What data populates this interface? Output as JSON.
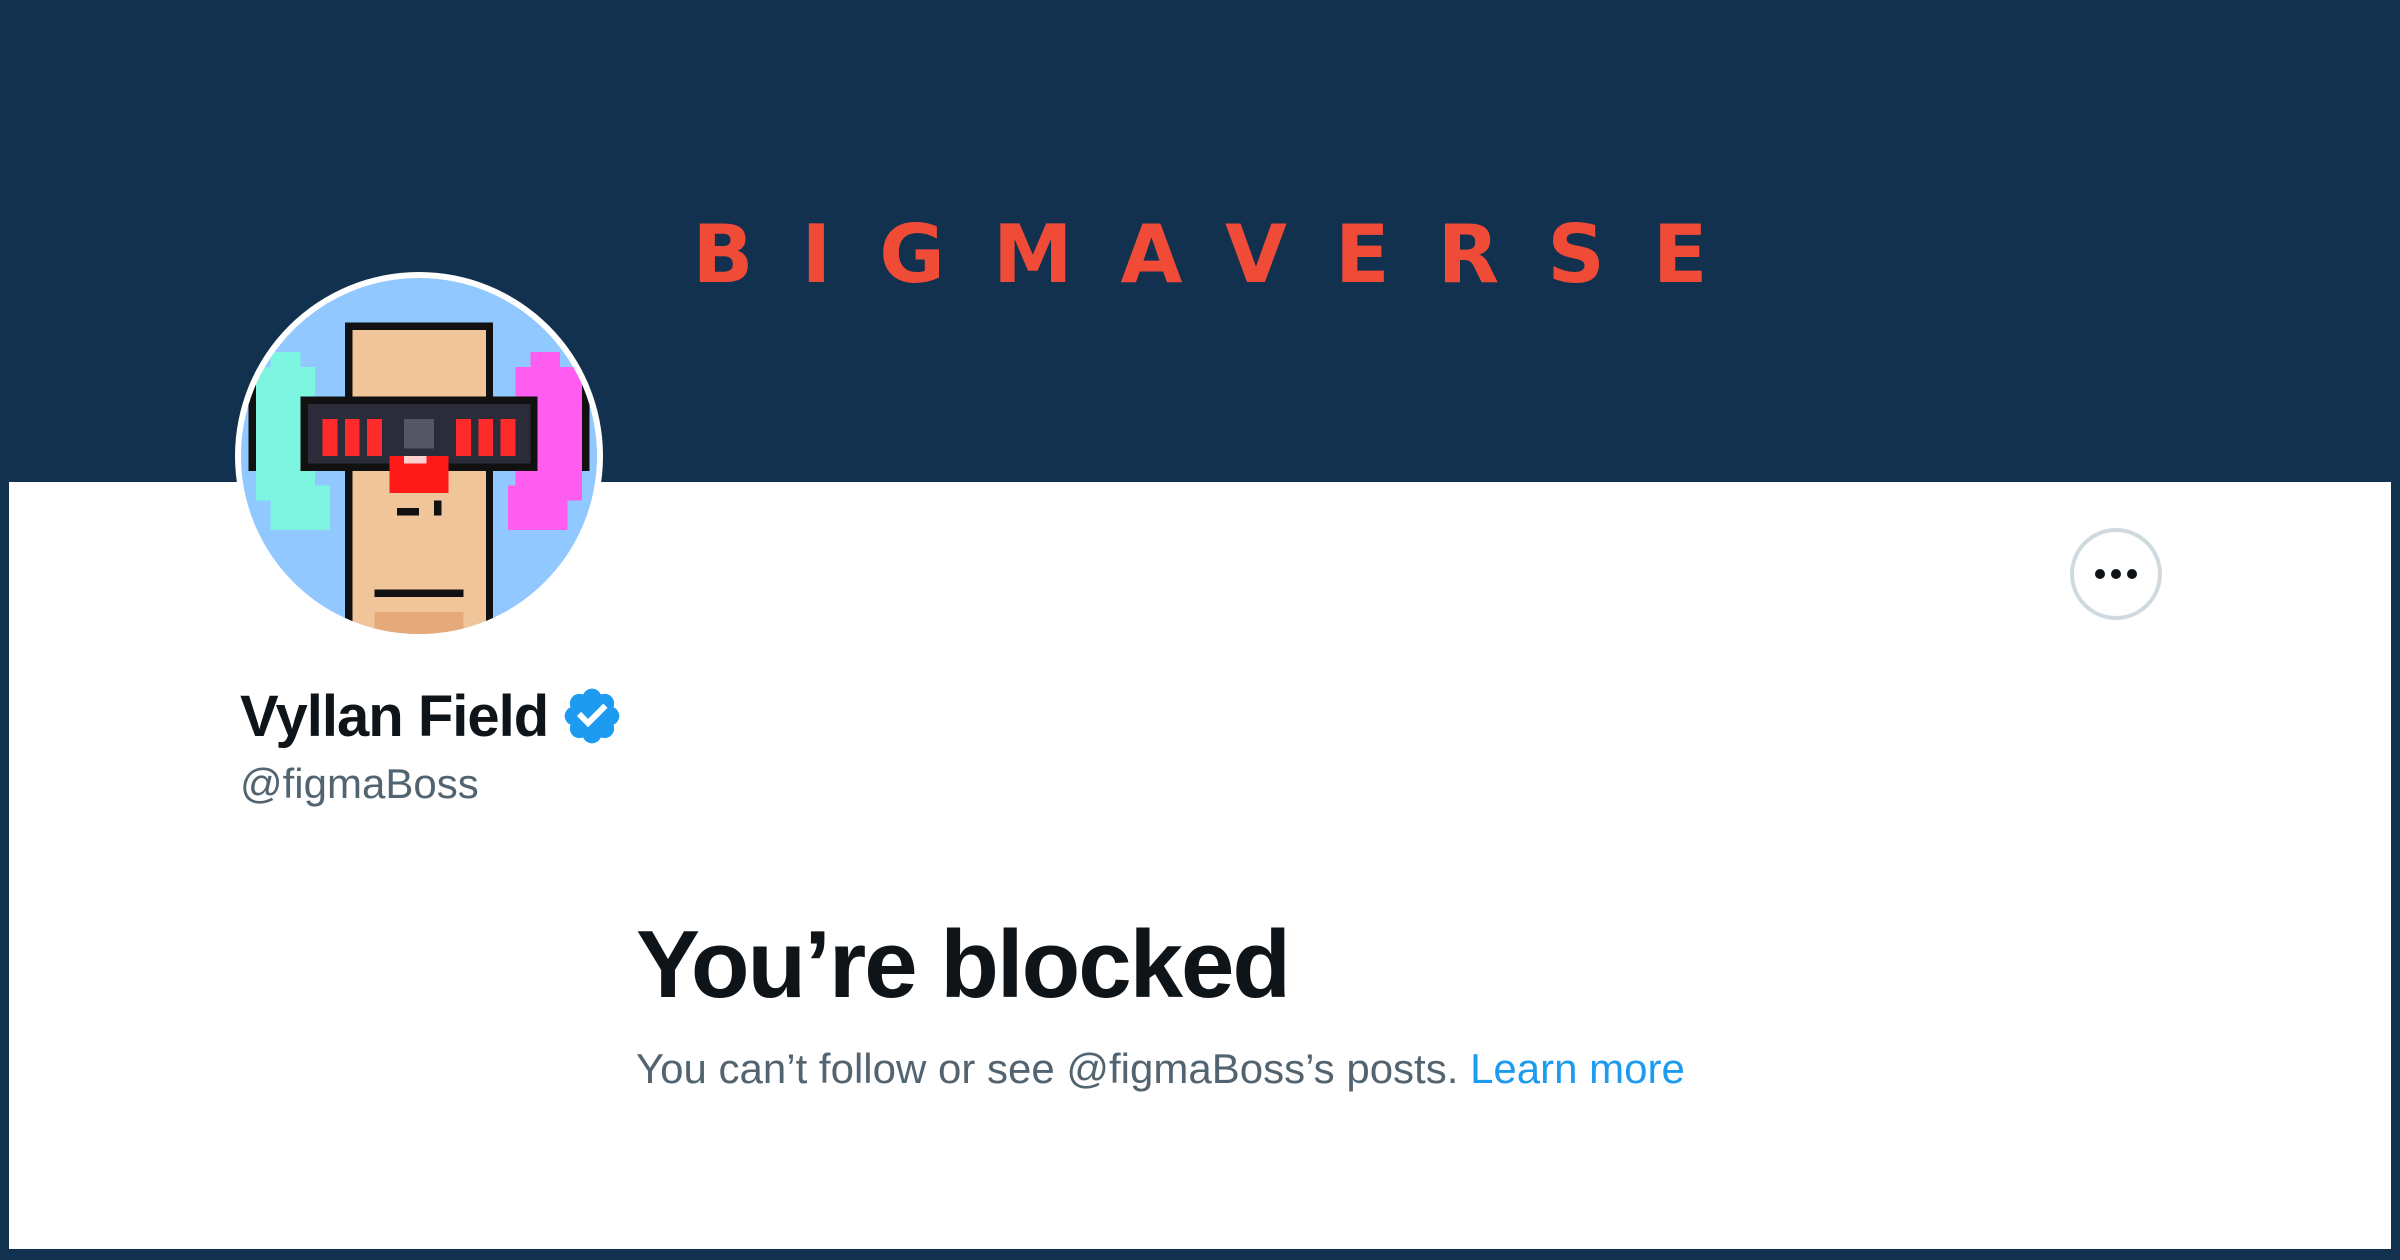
{
  "banner": {
    "title": "BIGMAVERSE",
    "background_color": "#12314e",
    "title_color": "#f04b37"
  },
  "profile": {
    "display_name": "Vyllan Field",
    "handle": "@figmaBoss",
    "verified": true,
    "avatar_icon": "pixel-art-avatar",
    "verified_icon": "verified-badge-icon",
    "more_icon": "more-options-icon"
  },
  "blocked": {
    "title": "You’re blocked",
    "description": "You can’t follow or see @figmaBoss’s posts.",
    "learn_more_label": "Learn more",
    "link_color": "#1d9bf0"
  }
}
